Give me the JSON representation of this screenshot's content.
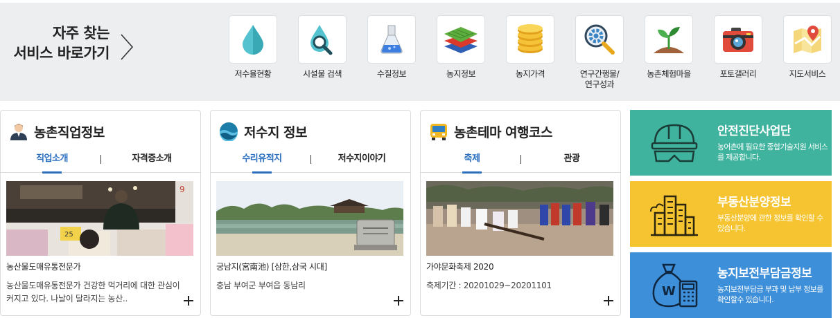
{
  "quick_menu": {
    "title_line1": "자주 찾는",
    "title_line2": "서비스 바로가기",
    "items": [
      {
        "label": "저수율현황",
        "icon": "water-drop-icon"
      },
      {
        "label": "시설물 검색",
        "icon": "search-drop-icon"
      },
      {
        "label": "수질정보",
        "icon": "flask-icon"
      },
      {
        "label": "농지정보",
        "icon": "layers-icon"
      },
      {
        "label": "농지가격",
        "icon": "coins-icon"
      },
      {
        "label": "연구간행물/\n연구성과",
        "icon": "gear-magnifier-icon"
      },
      {
        "label": "농촌체험마을",
        "icon": "sprout-icon"
      },
      {
        "label": "포토갤러리",
        "icon": "camera-icon"
      },
      {
        "label": "지도서비스",
        "icon": "map-pin-icon"
      }
    ]
  },
  "cards": [
    {
      "title": "농촌직업정보",
      "icon": "person-icon",
      "tabs": [
        "직업소개",
        "자격증소개"
      ],
      "active_tab": 0,
      "item_title": "농산물도매유통전문가",
      "item_desc": "농산물도매유통전문가 건강한 먹거리에 대한 관심이 커지고 있다. 나날이 달라지는 농산.."
    },
    {
      "title": "저수지 정보",
      "icon": "reservoir-icon",
      "tabs": [
        "수리유적지",
        "저수지이야기"
      ],
      "active_tab": 0,
      "item_title": "궁남지(宮南池) [삼한,삼국 시대]",
      "item_desc": "충남 부여군 부여읍 동남리"
    },
    {
      "title": "농촌테마 여행코스",
      "icon": "bus-icon",
      "tabs": [
        "축제",
        "관광"
      ],
      "active_tab": 0,
      "item_title": "가야문화축제 2020",
      "item_desc": "축제기간 : 20201029~20201101"
    }
  ],
  "banners": [
    {
      "title": "안전진단사업단",
      "desc": "농어촌에 필요한 종합기술지원 서비스를 제공합니다.",
      "color": "#3fb39d",
      "icon": "safety-helmet-icon"
    },
    {
      "title": "부동산분양정보",
      "desc": "부동산분양에 관한 정보를 확인할 수 있습니다.",
      "color": "#f5c430",
      "icon": "buildings-icon"
    },
    {
      "title": "농지보전부담금정보",
      "desc": "농지보전부담금 부과 및 납부 정보를 확인할수 있습니다.",
      "color": "#3d8fd9",
      "icon": "money-bag-calculator-icon"
    }
  ],
  "colors": {
    "accent": "#2a6fbf",
    "band": "#eceef0"
  }
}
